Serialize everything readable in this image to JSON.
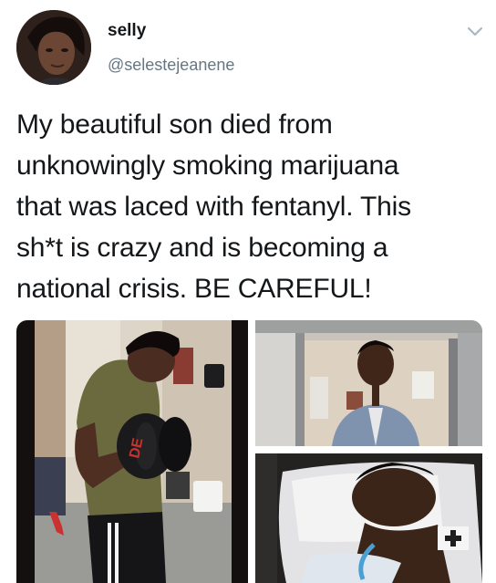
{
  "tweet": {
    "display_name": "selly",
    "handle": "@selestejeanene",
    "text": "My beautiful son died from\nunknowingly smoking marijuana\nthat was laced with fentanyl. This\nsh*t is crazy and is becoming a\nnational crisis. BE CAREFUL!",
    "photos": [
      {
        "printed_text": "DE"
      },
      {},
      {}
    ]
  },
  "icons": {
    "more_options": "chevron-down-icon"
  },
  "colors": {
    "text": "#14171a",
    "secondary_text": "#657786",
    "chevron": "#aab8c2"
  }
}
